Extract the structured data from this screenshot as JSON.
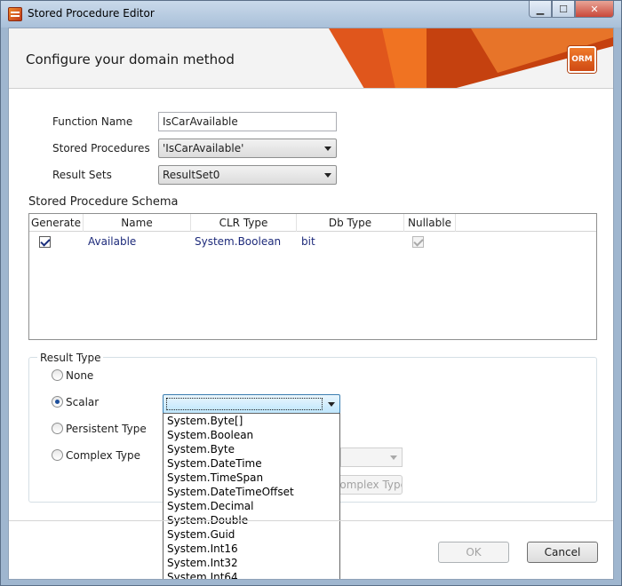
{
  "window": {
    "title": "Stored Procedure Editor",
    "minimize": "▁",
    "maximize": "☐",
    "close": "✕"
  },
  "header": {
    "title": "Configure your domain method",
    "logo_text": "ORM"
  },
  "form": {
    "function_name_label": "Function Name",
    "function_name_value": "IsCarAvailable",
    "stored_procedures_label": "Stored Procedures",
    "stored_procedures_value": "'IsCarAvailable'",
    "result_sets_label": "Result Sets",
    "result_sets_value": "ResultSet0"
  },
  "schema": {
    "title": "Stored Procedure Schema",
    "columns": [
      "Generate",
      "Name",
      "CLR Type",
      "Db Type",
      "Nullable"
    ],
    "rows": [
      {
        "generate": true,
        "name": "Available",
        "clr_type": "System.Boolean",
        "db_type": "bit",
        "nullable": true
      }
    ]
  },
  "result_type": {
    "title": "Result Type",
    "options": [
      "None",
      "Scalar",
      "Persistent Type",
      "Complex Type"
    ],
    "selected": "Scalar",
    "complex_type_button": "Complex Type",
    "scalar_dropdown_items": [
      "System.Byte[]",
      "System.Boolean",
      "System.Byte",
      "System.DateTime",
      "System.TimeSpan",
      "System.DateTimeOffset",
      "System.Decimal",
      "System.Double",
      "System.Guid",
      "System.Int16",
      "System.Int32",
      "System.Int64"
    ]
  },
  "footer": {
    "ok_label": "OK",
    "cancel_label": "Cancel"
  }
}
